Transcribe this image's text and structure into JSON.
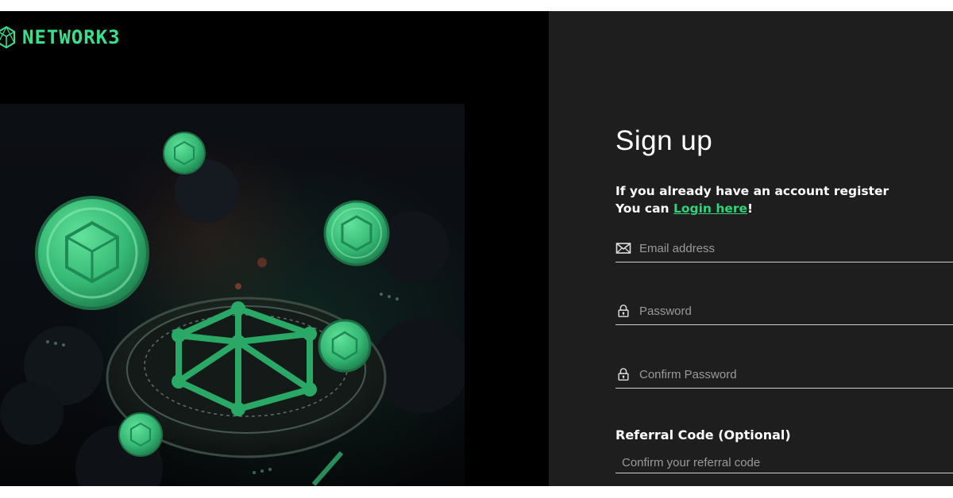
{
  "brand": {
    "name": "NETWORK3",
    "icon": "network3-logo-icon",
    "color": "#37e08c"
  },
  "hero": {
    "image": "network3-coins-illustration",
    "accent": "#36c47a"
  },
  "signup": {
    "title": "Sign up",
    "subtitle_line1": "If you already have an account register",
    "subtitle_prefix": "You can ",
    "login_link": "Login here",
    "subtitle_suffix": "!",
    "link_color": "#2ed47a"
  },
  "fields": {
    "email": {
      "placeholder": "Email address",
      "icon": "envelope-icon"
    },
    "password": {
      "placeholder": "Password",
      "icon": "lock-icon"
    },
    "confirm_password": {
      "placeholder": "Confirm Password",
      "icon": "lock-icon"
    }
  },
  "referral": {
    "label": "Referral Code (Optional)",
    "placeholder": "Confirm your referral code"
  },
  "colors": {
    "panel_bg": "#1e1e1e",
    "hero_bg": "#000000"
  }
}
